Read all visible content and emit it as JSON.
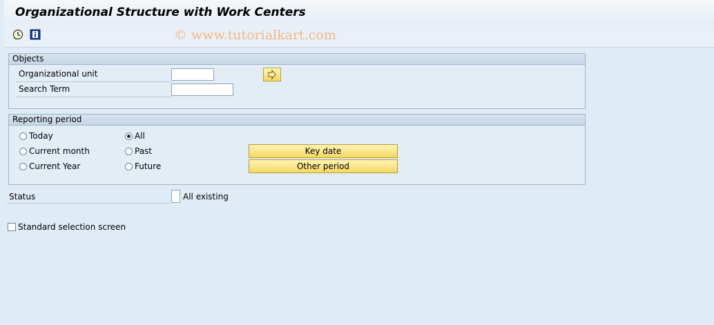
{
  "window": {
    "title": "Organizational Structure with Work Centers"
  },
  "toolbar": {
    "execute_icon": "execute-clock-icon",
    "info_icon": "info-icon",
    "watermark": "© www.tutorialkart.com"
  },
  "objects": {
    "header": "Objects",
    "org_unit_label": "Organizational unit",
    "org_unit_value": "",
    "search_term_label": "Search Term",
    "search_term_value": ""
  },
  "reporting_period": {
    "header": "Reporting period",
    "options": [
      {
        "label": "Today",
        "selected": false
      },
      {
        "label": "Current month",
        "selected": false
      },
      {
        "label": "Current Year",
        "selected": false
      },
      {
        "label": "All",
        "selected": true
      },
      {
        "label": "Past",
        "selected": false
      },
      {
        "label": "Future",
        "selected": false
      }
    ],
    "key_date_button": "Key date",
    "other_period_button": "Other period"
  },
  "status": {
    "label": "Status",
    "value_text": "All existing"
  },
  "standard_selection": {
    "label": "Standard selection screen",
    "checked": false
  },
  "colors": {
    "background": "#dfebf5",
    "button_yellow": "#f5d964"
  }
}
